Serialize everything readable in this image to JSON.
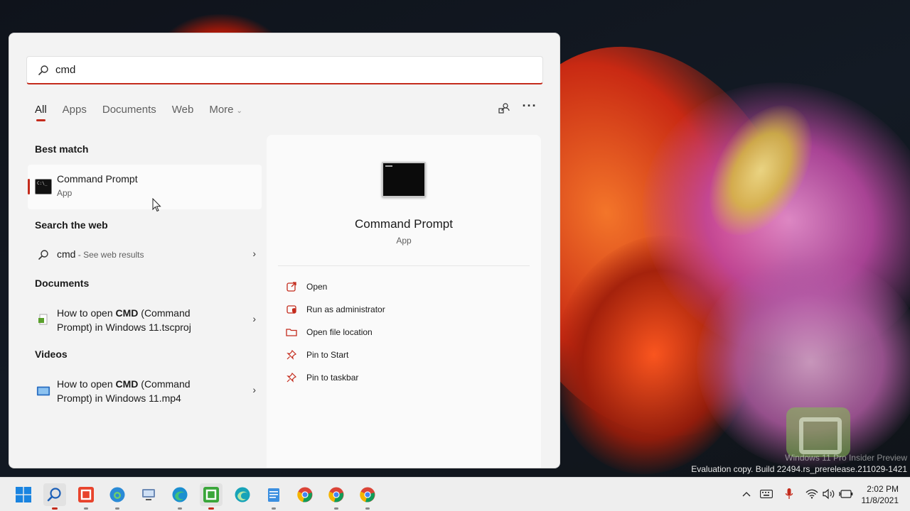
{
  "search": {
    "query": "cmd"
  },
  "tabs": [
    {
      "label": "All"
    },
    {
      "label": "Apps"
    },
    {
      "label": "Documents"
    },
    {
      "label": "Web"
    },
    {
      "label": "More"
    }
  ],
  "sections": {
    "best_match": "Best match",
    "search_web": "Search the web",
    "documents": "Documents",
    "videos": "Videos"
  },
  "best_match": {
    "name": "Command Prompt",
    "type": "App"
  },
  "web_result": {
    "query": "cmd",
    "suffix": " - See web results"
  },
  "document_result": {
    "prefix": "How to open ",
    "bold": "CMD",
    "line1_rest": " (Command",
    "line2": "Prompt) in Windows 11.tscproj"
  },
  "video_result": {
    "prefix": "How to open ",
    "bold": "CMD",
    "line1_rest": " (Command",
    "line2": "Prompt) in Windows 11.mp4"
  },
  "preview": {
    "title": "Command Prompt",
    "subtitle": "App",
    "actions": [
      {
        "label": "Open",
        "icon": "open-external-icon"
      },
      {
        "label": "Run as administrator",
        "icon": "shield-admin-icon"
      },
      {
        "label": "Open file location",
        "icon": "folder-icon"
      },
      {
        "label": "Pin to Start",
        "icon": "pin-icon"
      },
      {
        "label": "Pin to taskbar",
        "icon": "pin-icon"
      }
    ]
  },
  "watermark": {
    "line1": "Windows 11 Pro Insider Preview",
    "line2": "Evaluation copy. Build 22494.rs_prerelease.211029-1421"
  },
  "clock": {
    "time": "2:02 PM",
    "date": "11/8/2021"
  },
  "colors": {
    "accent": "#c42b1c",
    "panel_bg": "#f3f3f3",
    "taskbar_bg": "#eeeeee"
  }
}
